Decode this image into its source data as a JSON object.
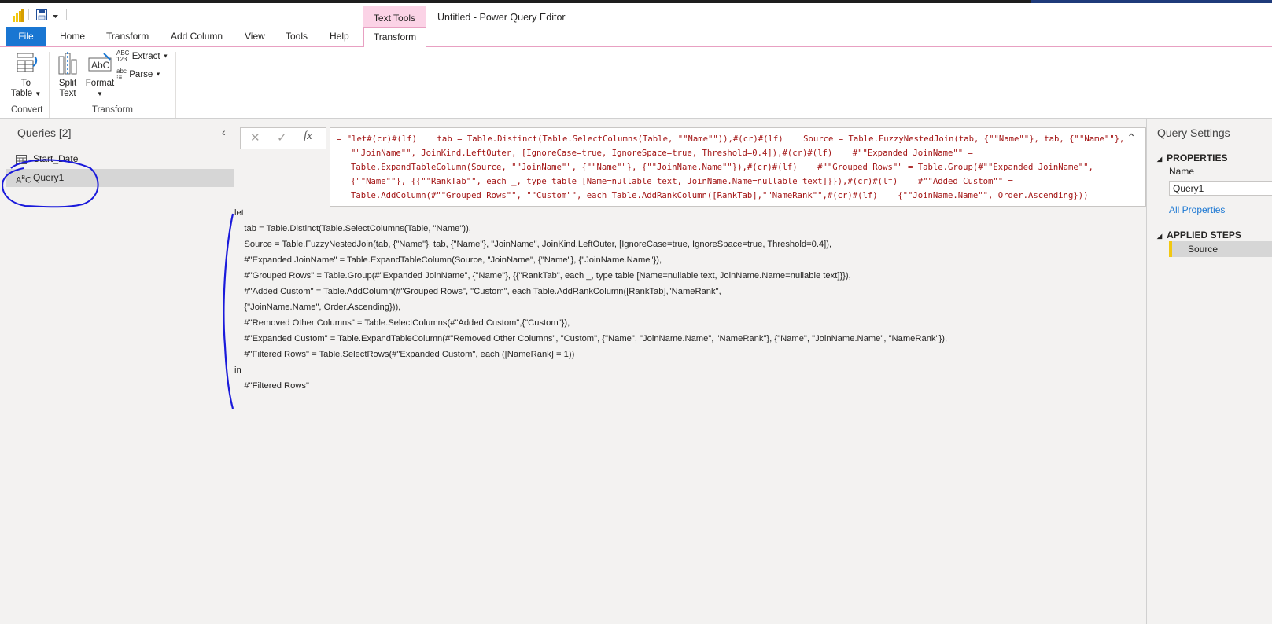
{
  "window": {
    "title": "Untitled - Power Query Editor",
    "context_group": "Text Tools"
  },
  "tabs": [
    {
      "label": "File"
    },
    {
      "label": "Home"
    },
    {
      "label": "Transform"
    },
    {
      "label": "Add Column"
    },
    {
      "label": "View"
    },
    {
      "label": "Tools"
    },
    {
      "label": "Help"
    },
    {
      "label": "Transform"
    }
  ],
  "ribbon": {
    "to_table_line1": "To",
    "to_table_line2": "Table",
    "convert_group": "Convert",
    "split_line1": "Split",
    "split_line2": "Text",
    "format": "Format",
    "extract": "Extract",
    "parse": "Parse",
    "transform_group": "Transform"
  },
  "queries": {
    "title": "Queries [2]",
    "items": [
      {
        "label": "Start_Date",
        "icon": "table-icon"
      },
      {
        "label": "Query1",
        "icon": "text-type-icon"
      }
    ]
  },
  "formula_bar": {
    "fx": "fx",
    "text": "= \"let#(cr)#(lf)    tab = Table.Distinct(Table.SelectColumns(Table, \"\"Name\"\")),#(cr)#(lf)    Source = Table.FuzzyNestedJoin(tab, {\"\"Name\"\"}, tab, {\"\"Name\"\"}, \"\"JoinName\"\", JoinKind.LeftOuter, [IgnoreCase=true, IgnoreSpace=true, Threshold=0.4]),#(cr)#(lf)    #\"\"Expanded JoinName\"\" = Table.ExpandTableColumn(Source, \"\"JoinName\"\", {\"\"Name\"\"}, {\"\"JoinName.Name\"\"}),#(cr)#(lf)    #\"\"Grouped Rows\"\" = Table.Group(#\"\"Expanded JoinName\"\", {\"\"Name\"\"}, {{\"\"RankTab\"\", each _, type table [Name=nullable text, JoinName.Name=nullable text]}}),#(cr)#(lf)    #\"\"Added Custom\"\" = Table.AddColumn(#\"\"Grouped Rows\"\", \"\"Custom\"\", each Table.AddRankColumn([RankTab],\"\"NameRank\"\",#(cr)#(lf)    {\"\"JoinName.Name\"\", Order.Ascending}))"
  },
  "code_lines": [
    "let",
    "    tab = Table.Distinct(Table.SelectColumns(Table, \"Name\")),",
    "    Source = Table.FuzzyNestedJoin(tab, {\"Name\"}, tab, {\"Name\"}, \"JoinName\", JoinKind.LeftOuter, [IgnoreCase=true, IgnoreSpace=true, Threshold=0.4]),",
    "    #\"Expanded JoinName\" = Table.ExpandTableColumn(Source, \"JoinName\", {\"Name\"}, {\"JoinName.Name\"}),",
    "    #\"Grouped Rows\" = Table.Group(#\"Expanded JoinName\", {\"Name\"}, {{\"RankTab\", each _, type table [Name=nullable text, JoinName.Name=nullable text]}}),",
    "    #\"Added Custom\" = Table.AddColumn(#\"Grouped Rows\", \"Custom\", each Table.AddRankColumn([RankTab],\"NameRank\",",
    "    {\"JoinName.Name\", Order.Ascending})),",
    "    #\"Removed Other Columns\" = Table.SelectColumns(#\"Added Custom\",{\"Custom\"}),",
    "    #\"Expanded Custom\" = Table.ExpandTableColumn(#\"Removed Other Columns\", \"Custom\", {\"Name\", \"JoinName.Name\", \"NameRank\"}, {\"Name\", \"JoinName.Name\", \"NameRank\"}),",
    "    #\"Filtered Rows\" = Table.SelectRows(#\"Expanded Custom\", each ([NameRank] = 1))",
    "in",
    "    #\"Filtered Rows\""
  ],
  "settings": {
    "title": "Query Settings",
    "properties": "PROPERTIES",
    "name_label": "Name",
    "name_value": "Query1",
    "all_properties": "All Properties",
    "applied_steps": "APPLIED STEPS",
    "steps": [
      {
        "label": "Source"
      }
    ]
  },
  "colors": {
    "accent": "#1976d2",
    "context_tab": "#fbd3e6",
    "annotation": "#1a1adb",
    "formula_text": "#a31515"
  }
}
